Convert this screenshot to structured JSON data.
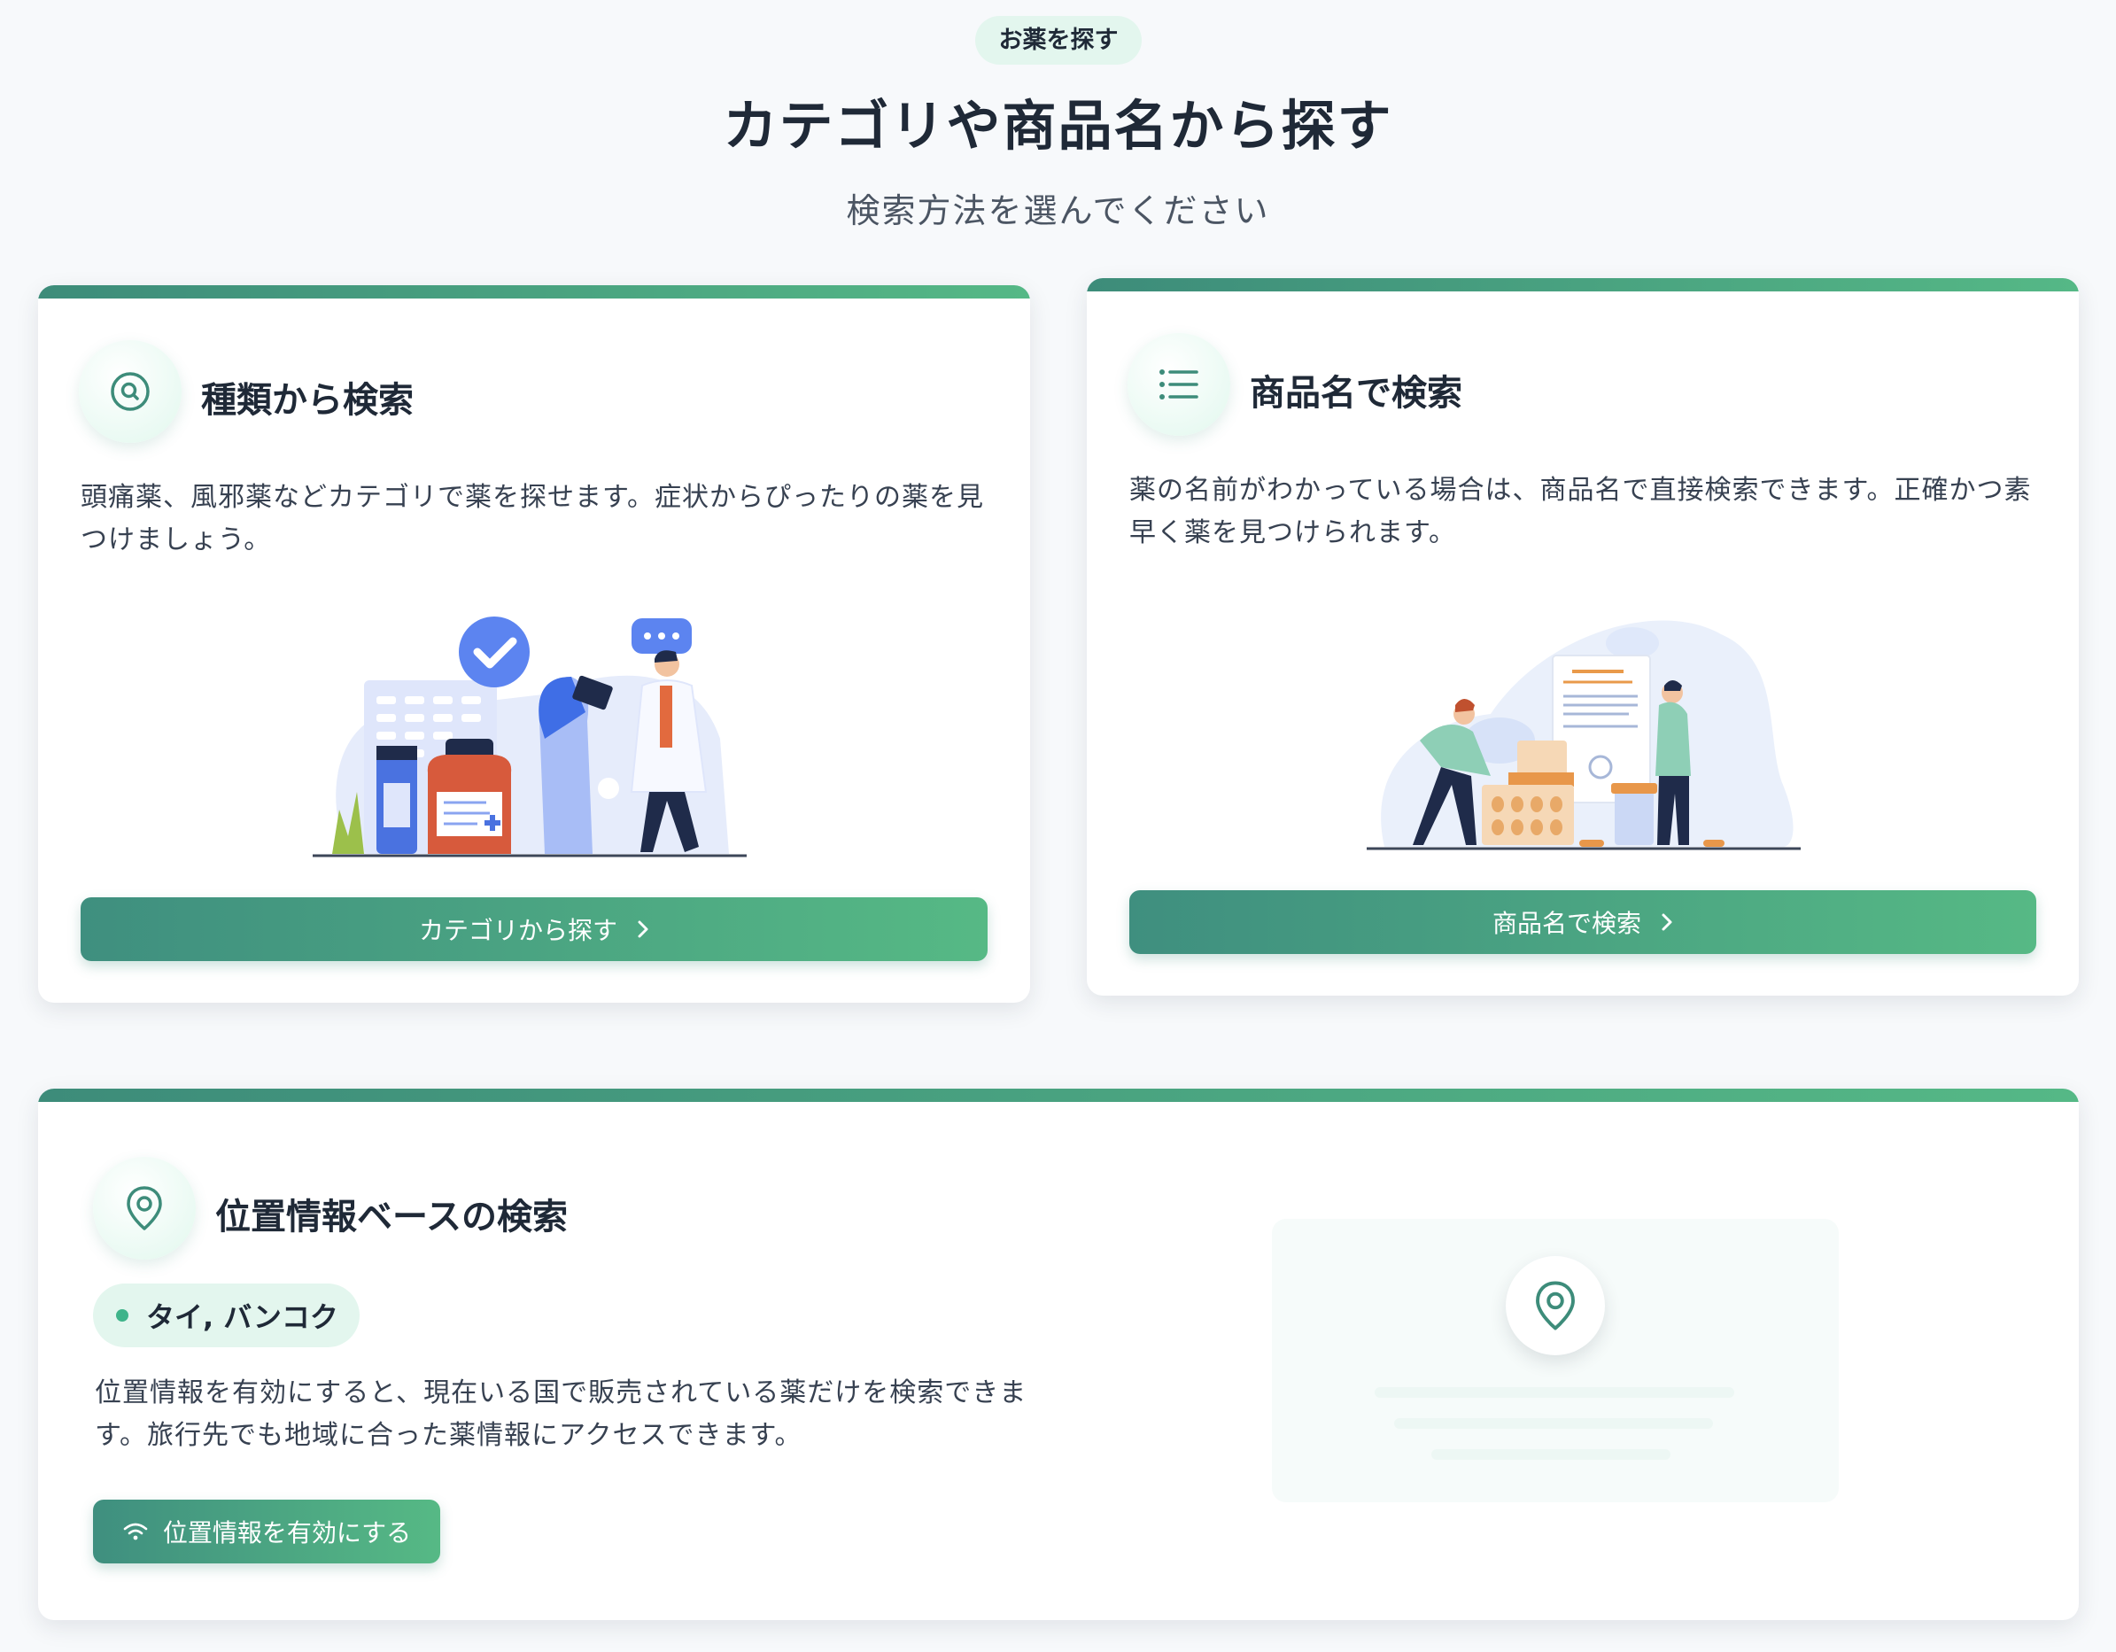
{
  "header": {
    "tag": "お薬を探す",
    "title": "カテゴリや商品名から探す",
    "subtitle": "検索方法を選んでください"
  },
  "cards": {
    "category": {
      "icon": "search-icon",
      "title": "種類から検索",
      "description": "頭痛薬、風邪薬などカテゴリで薬を探せます。症状からぴったりの薬を見つけましょう。",
      "button_label": "カテゴリから探す"
    },
    "product": {
      "icon": "list-icon",
      "title": "商品名で検索",
      "description": "薬の名前がわかっている場合は、商品名で直接検索できます。正確かつ素早く薬を見つけられます。",
      "button_label": "商品名で検索"
    },
    "location": {
      "icon": "map-pin-icon",
      "title": "位置情報ベースの検索",
      "location_label": "タイ, バンコク",
      "description": "位置情報を有効にすると、現在いる国で販売されている薬だけを検索できます。旅行先でも地域に合った薬情報にアクセスできます。",
      "button_label": "位置情報を有効にする",
      "button_icon": "wifi-icon"
    }
  },
  "colors": {
    "accent_start": "#3d8c7a",
    "accent_end": "#55b886",
    "tag_background": "#e3f6ee",
    "page_background": "#f7f9fb"
  }
}
